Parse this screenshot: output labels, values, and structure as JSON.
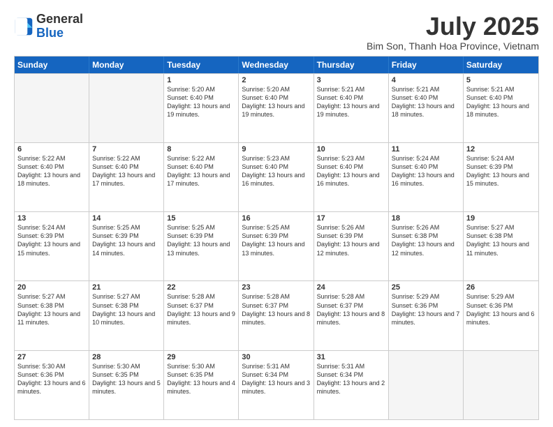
{
  "logo": {
    "line1": "General",
    "line2": "Blue"
  },
  "title": "July 2025",
  "subtitle": "Bim Son, Thanh Hoa Province, Vietnam",
  "header_days": [
    "Sunday",
    "Monday",
    "Tuesday",
    "Wednesday",
    "Thursday",
    "Friday",
    "Saturday"
  ],
  "weeks": [
    [
      {
        "day": "",
        "info": ""
      },
      {
        "day": "",
        "info": ""
      },
      {
        "day": "1",
        "info": "Sunrise: 5:20 AM\nSunset: 6:40 PM\nDaylight: 13 hours and 19 minutes."
      },
      {
        "day": "2",
        "info": "Sunrise: 5:20 AM\nSunset: 6:40 PM\nDaylight: 13 hours and 19 minutes."
      },
      {
        "day": "3",
        "info": "Sunrise: 5:21 AM\nSunset: 6:40 PM\nDaylight: 13 hours and 19 minutes."
      },
      {
        "day": "4",
        "info": "Sunrise: 5:21 AM\nSunset: 6:40 PM\nDaylight: 13 hours and 18 minutes."
      },
      {
        "day": "5",
        "info": "Sunrise: 5:21 AM\nSunset: 6:40 PM\nDaylight: 13 hours and 18 minutes."
      }
    ],
    [
      {
        "day": "6",
        "info": "Sunrise: 5:22 AM\nSunset: 6:40 PM\nDaylight: 13 hours and 18 minutes."
      },
      {
        "day": "7",
        "info": "Sunrise: 5:22 AM\nSunset: 6:40 PM\nDaylight: 13 hours and 17 minutes."
      },
      {
        "day": "8",
        "info": "Sunrise: 5:22 AM\nSunset: 6:40 PM\nDaylight: 13 hours and 17 minutes."
      },
      {
        "day": "9",
        "info": "Sunrise: 5:23 AM\nSunset: 6:40 PM\nDaylight: 13 hours and 16 minutes."
      },
      {
        "day": "10",
        "info": "Sunrise: 5:23 AM\nSunset: 6:40 PM\nDaylight: 13 hours and 16 minutes."
      },
      {
        "day": "11",
        "info": "Sunrise: 5:24 AM\nSunset: 6:40 PM\nDaylight: 13 hours and 16 minutes."
      },
      {
        "day": "12",
        "info": "Sunrise: 5:24 AM\nSunset: 6:39 PM\nDaylight: 13 hours and 15 minutes."
      }
    ],
    [
      {
        "day": "13",
        "info": "Sunrise: 5:24 AM\nSunset: 6:39 PM\nDaylight: 13 hours and 15 minutes."
      },
      {
        "day": "14",
        "info": "Sunrise: 5:25 AM\nSunset: 6:39 PM\nDaylight: 13 hours and 14 minutes."
      },
      {
        "day": "15",
        "info": "Sunrise: 5:25 AM\nSunset: 6:39 PM\nDaylight: 13 hours and 13 minutes."
      },
      {
        "day": "16",
        "info": "Sunrise: 5:25 AM\nSunset: 6:39 PM\nDaylight: 13 hours and 13 minutes."
      },
      {
        "day": "17",
        "info": "Sunrise: 5:26 AM\nSunset: 6:39 PM\nDaylight: 13 hours and 12 minutes."
      },
      {
        "day": "18",
        "info": "Sunrise: 5:26 AM\nSunset: 6:38 PM\nDaylight: 13 hours and 12 minutes."
      },
      {
        "day": "19",
        "info": "Sunrise: 5:27 AM\nSunset: 6:38 PM\nDaylight: 13 hours and 11 minutes."
      }
    ],
    [
      {
        "day": "20",
        "info": "Sunrise: 5:27 AM\nSunset: 6:38 PM\nDaylight: 13 hours and 11 minutes."
      },
      {
        "day": "21",
        "info": "Sunrise: 5:27 AM\nSunset: 6:38 PM\nDaylight: 13 hours and 10 minutes."
      },
      {
        "day": "22",
        "info": "Sunrise: 5:28 AM\nSunset: 6:37 PM\nDaylight: 13 hours and 9 minutes."
      },
      {
        "day": "23",
        "info": "Sunrise: 5:28 AM\nSunset: 6:37 PM\nDaylight: 13 hours and 8 minutes."
      },
      {
        "day": "24",
        "info": "Sunrise: 5:28 AM\nSunset: 6:37 PM\nDaylight: 13 hours and 8 minutes."
      },
      {
        "day": "25",
        "info": "Sunrise: 5:29 AM\nSunset: 6:36 PM\nDaylight: 13 hours and 7 minutes."
      },
      {
        "day": "26",
        "info": "Sunrise: 5:29 AM\nSunset: 6:36 PM\nDaylight: 13 hours and 6 minutes."
      }
    ],
    [
      {
        "day": "27",
        "info": "Sunrise: 5:30 AM\nSunset: 6:36 PM\nDaylight: 13 hours and 6 minutes."
      },
      {
        "day": "28",
        "info": "Sunrise: 5:30 AM\nSunset: 6:35 PM\nDaylight: 13 hours and 5 minutes."
      },
      {
        "day": "29",
        "info": "Sunrise: 5:30 AM\nSunset: 6:35 PM\nDaylight: 13 hours and 4 minutes."
      },
      {
        "day": "30",
        "info": "Sunrise: 5:31 AM\nSunset: 6:34 PM\nDaylight: 13 hours and 3 minutes."
      },
      {
        "day": "31",
        "info": "Sunrise: 5:31 AM\nSunset: 6:34 PM\nDaylight: 13 hours and 2 minutes."
      },
      {
        "day": "",
        "info": ""
      },
      {
        "day": "",
        "info": ""
      }
    ]
  ]
}
